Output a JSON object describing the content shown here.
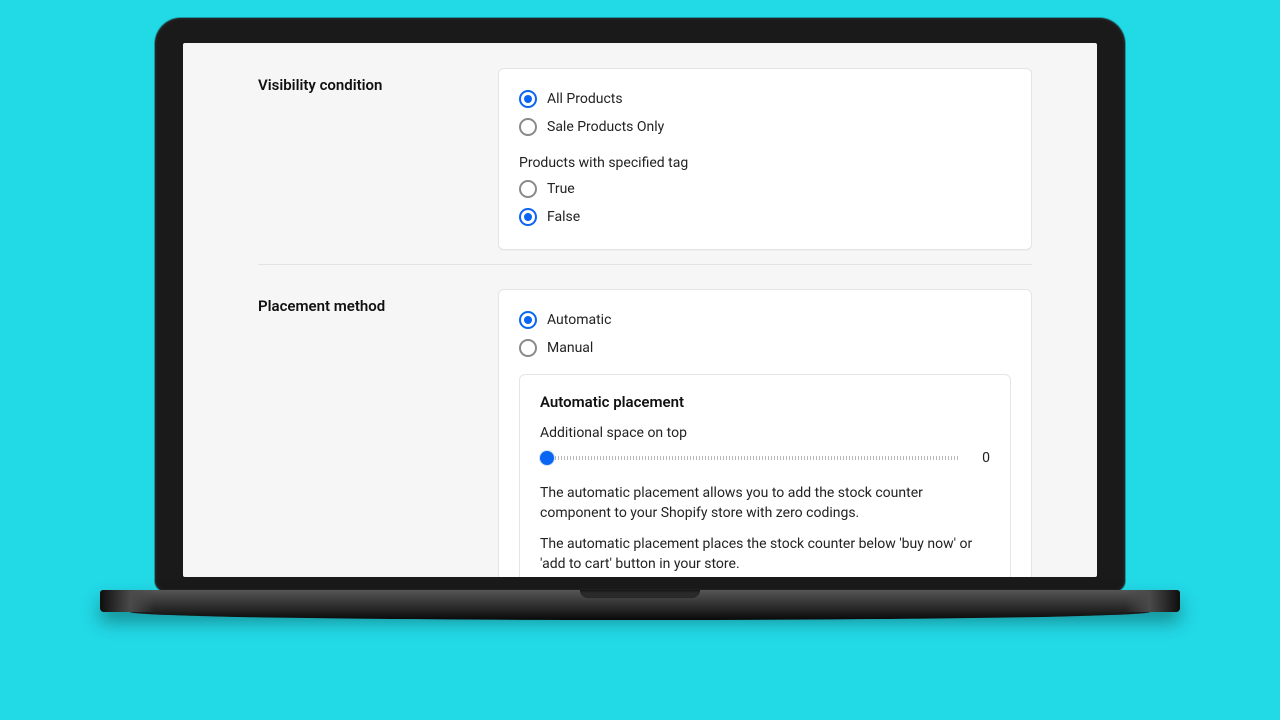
{
  "sections": {
    "visibility": {
      "title": "Visibility condition",
      "options": {
        "all_products": "All Products",
        "sale_only": "Sale Products Only"
      },
      "selected_option": "all_products",
      "tag_group": {
        "label": "Products with specified tag",
        "options": {
          "true": "True",
          "false": "False"
        },
        "selected": "false"
      }
    },
    "placement": {
      "title": "Placement method",
      "options": {
        "automatic": "Automatic",
        "manual": "Manual"
      },
      "selected_option": "automatic",
      "automatic_card": {
        "title": "Automatic placement",
        "slider_label": "Additional space on top",
        "slider_value": "0",
        "help1": "The automatic placement allows you to add the stock counter component to your Shopify store with zero codings.",
        "help2": "The automatic placement places the stock counter below 'buy now' or 'add to cart' button in your store."
      }
    }
  }
}
